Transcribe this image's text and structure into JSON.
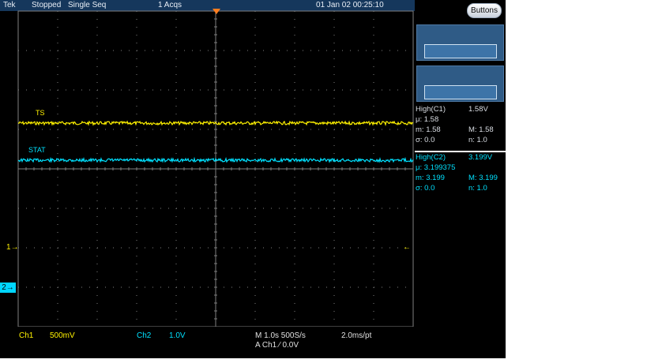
{
  "colors": {
    "bg": "#000000",
    "grid": "#7f7f7f",
    "ch1": "#fff200",
    "ch2": "#00e1ff",
    "header": "#15375c",
    "trigger": "#ff7e1f"
  },
  "header": {
    "brand": "Tek",
    "status": "Stopped",
    "mode": "Single Seq",
    "acqs": "1 Acqs",
    "datetime": "01 Jan 02 00:25:10"
  },
  "buttons_label": "Buttons",
  "traces": {
    "ch1": {
      "label": "TS",
      "level": 1.58,
      "ground_marker": "1"
    },
    "ch2": {
      "label": "STAT",
      "level": 3.199,
      "ground_marker": "2"
    }
  },
  "measurements": {
    "m1": {
      "title": "High(C1)",
      "value": "1.58V",
      "mu": "μ: 1.58",
      "min": "m: 1.58",
      "max": "M: 1.58",
      "sigma": "σ: 0.0",
      "n": "n: 1.0"
    },
    "m2": {
      "title": "High(C2)",
      "value": "3.199V",
      "mu": "μ: 3.199375",
      "min": "m: 3.199",
      "max": "M: 3.199",
      "sigma": "σ: 0.0",
      "n": "n: 1.0"
    }
  },
  "bottom": {
    "ch1_name": "Ch1",
    "ch1_scale": "500mV",
    "ch2_name": "Ch2",
    "ch2_scale": "1.0V",
    "timebase": "M 1.0s 500S/s",
    "trigger": "A Ch1  ∕  0.0V",
    "record": "2.0ms/pt"
  }
}
